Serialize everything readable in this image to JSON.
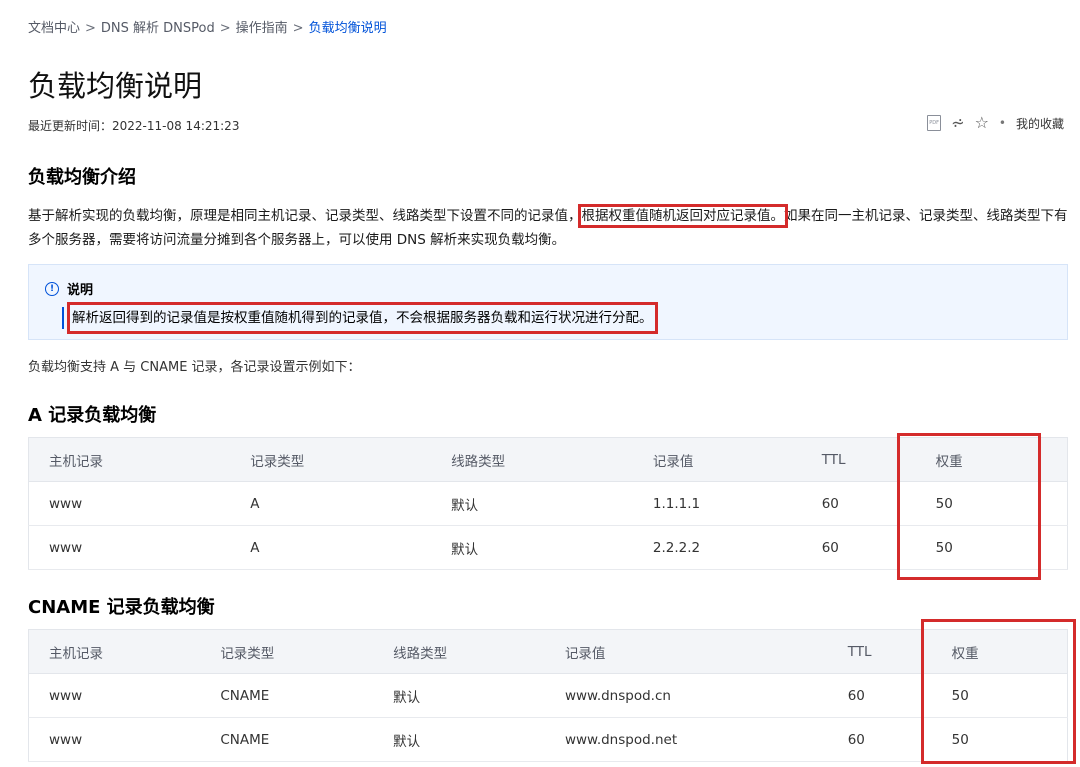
{
  "breadcrumb": {
    "items": [
      "文档中心",
      "DNS 解析 DNSPod",
      "操作指南"
    ],
    "current": "负载均衡说明",
    "separator": ">"
  },
  "page": {
    "title": "负载均衡说明",
    "updated": "最近更新时间：2022-11-08 14:21:23"
  },
  "toolbar": {
    "pdf_label": "PDF",
    "pdf_icon": "pdf-icon",
    "share_icon": "share-icon",
    "share_glyph": "⩫",
    "star_icon": "star-outline-icon",
    "star_glyph": "☆",
    "favorites_label": "我的收藏"
  },
  "intro": {
    "heading": "负载均衡介绍",
    "para_before": "基于解析实现的负载均衡，原理是相同主机记录、记录类型、线路类型下设置不同的记录值，",
    "para_highlight": "根据权重值随机返回对应记录值。",
    "para_after": "如果在同一主机记录、记录类型、线路类型下有多个服务器，需要将访问流量分摊到各个服务器上，可以使用 DNS 解析来实现负载均衡。"
  },
  "note": {
    "icon": "info-icon",
    "icon_glyph": "!",
    "title": "说明",
    "text": "解析返回得到的记录值是按权重值随机得到的记录值，不会根据服务器负载和运行状况进行分配。"
  },
  "support_text": "负载均衡支持 A  与 CNAME 记录，各记录设置示例如下：",
  "table_a": {
    "heading": "A 记录负载均衡",
    "headers": [
      "主机记录",
      "记录类型",
      "线路类型",
      "记录值",
      "TTL",
      "权重"
    ],
    "rows": [
      [
        "www",
        "A",
        "默认",
        "1.1.1.1",
        "60",
        "50"
      ],
      [
        "www",
        "A",
        "默认",
        "2.2.2.2",
        "60",
        "50"
      ]
    ]
  },
  "table_cname": {
    "heading": "CNAME 记录负载均衡",
    "headers": [
      "主机记录",
      "记录类型",
      "线路类型",
      "记录值",
      "TTL",
      "权重"
    ],
    "rows": [
      [
        "www",
        "CNAME",
        "默认",
        "www.dnspod.cn",
        "60",
        "50"
      ],
      [
        "www",
        "CNAME",
        "默认",
        "www.dnspod.net",
        "60",
        "50"
      ]
    ]
  },
  "colors": {
    "link_blue": "#0052d9",
    "annotation_red": "#d42b2b",
    "note_bg": "#f0f6ff",
    "table_header_bg": "#f3f5f8"
  }
}
